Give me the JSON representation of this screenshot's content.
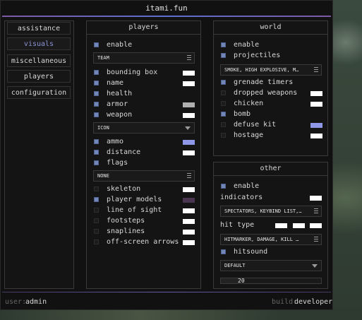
{
  "app": {
    "title": "itami.fun",
    "accent": "#7c5aa6"
  },
  "sidebar": {
    "items": [
      {
        "label": "assistance",
        "active": false
      },
      {
        "label": "visuals",
        "active": true
      },
      {
        "label": "miscellaneous",
        "active": false
      },
      {
        "label": "players",
        "active": false
      },
      {
        "label": "configuration",
        "active": false
      }
    ]
  },
  "players": {
    "title": "players",
    "enable": {
      "label": "enable",
      "checked": true
    },
    "team_select": "TEAM",
    "items1": [
      {
        "label": "bounding box",
        "checked": true,
        "color": "#ffffff"
      },
      {
        "label": "name",
        "checked": true,
        "color": "#ffffff"
      },
      {
        "label": "health",
        "checked": true,
        "color": null
      },
      {
        "label": "armor",
        "checked": true,
        "color": "#b0b0b0"
      },
      {
        "label": "weapon",
        "checked": true,
        "color": "#ffffff"
      }
    ],
    "icon_select": "ICON",
    "items2": [
      {
        "label": "ammo",
        "checked": true,
        "color": "#8f97e8"
      },
      {
        "label": "distance",
        "checked": true,
        "color": "#ffffff"
      },
      {
        "label": "flags",
        "checked": true,
        "color": null
      }
    ],
    "none_select": "NONE",
    "items3": [
      {
        "label": "skeleton",
        "checked": false,
        "color": "#ffffff"
      },
      {
        "label": "player models",
        "checked": true,
        "color": "#4a3550"
      },
      {
        "label": "line of sight",
        "checked": false,
        "color": "#ffffff"
      },
      {
        "label": "footsteps",
        "checked": false,
        "color": "#ffffff"
      },
      {
        "label": "snaplines",
        "checked": false,
        "color": "#ffffff"
      },
      {
        "label": "off-screen arrows",
        "checked": false,
        "color": "#ffffff"
      }
    ]
  },
  "world": {
    "title": "world",
    "items1": [
      {
        "label": "enable",
        "checked": true
      },
      {
        "label": "projectiles",
        "checked": true
      }
    ],
    "projectiles_select": "SMOKE, HIGH EXPLOSIVE, M…",
    "items2": [
      {
        "label": "grenade timers",
        "checked": true,
        "color": null
      },
      {
        "label": "dropped weapons",
        "checked": false,
        "color": "#ffffff"
      },
      {
        "label": "chicken",
        "checked": false,
        "color": "#ffffff"
      },
      {
        "label": "bomb",
        "checked": true,
        "color": null
      },
      {
        "label": "defuse kit",
        "checked": false,
        "color": "#8f97e8"
      },
      {
        "label": "hostage",
        "checked": false,
        "color": "#ffffff"
      }
    ]
  },
  "other": {
    "title": "other",
    "enable": {
      "label": "enable",
      "checked": true
    },
    "indicators_label": "indicators",
    "indicators_select": "SPECTATORS, KEYBIND LIST,…",
    "hit_type_label": "hit type",
    "hit_type_select": "HITMARKER, DAMAGE, KILL …",
    "hitsound": {
      "label": "hitsound",
      "checked": true
    },
    "sound_select": "DEFAULT",
    "slider_value": "20"
  },
  "footer": {
    "user_prefix": "user:",
    "user": "admin",
    "build_prefix": "build:",
    "build": "developer"
  }
}
